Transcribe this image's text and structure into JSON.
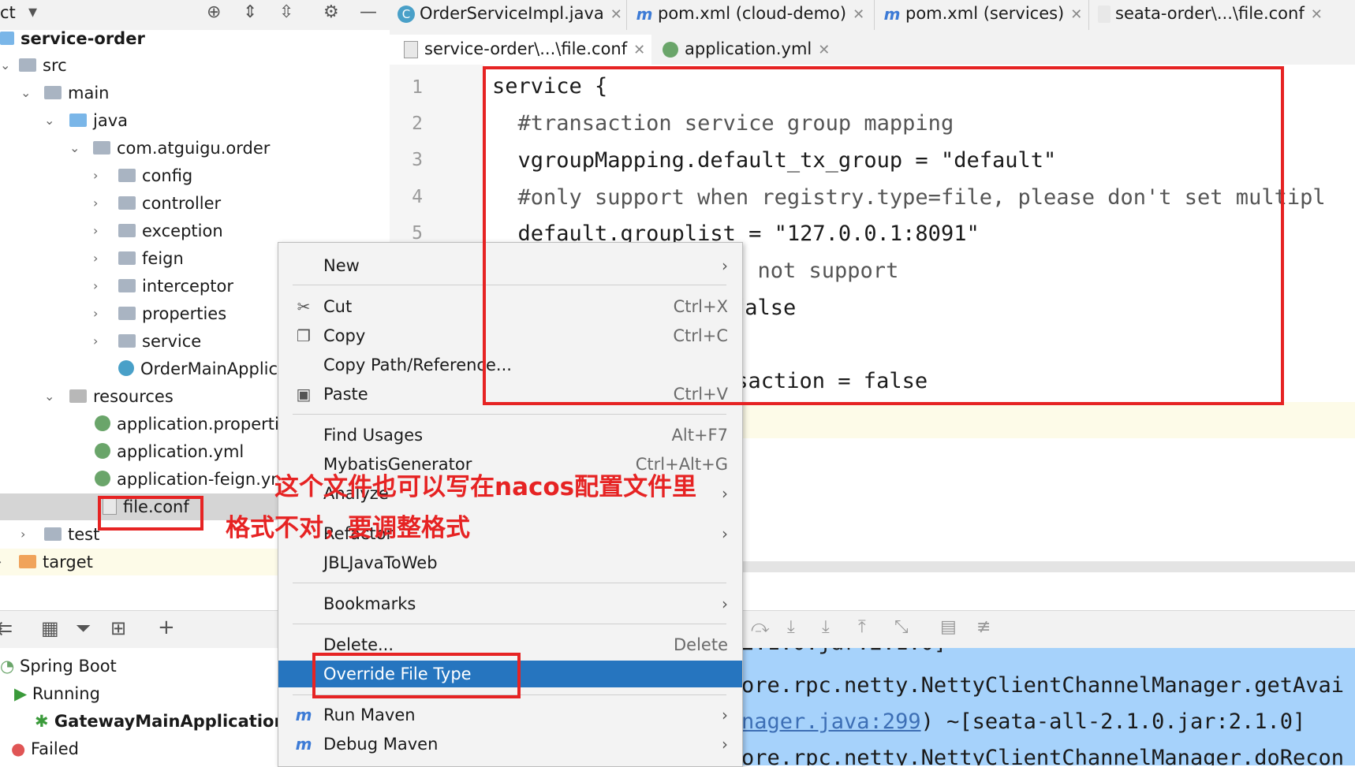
{
  "project_toolbar": {
    "title": "ct"
  },
  "editor_tabs_row1": [
    {
      "label": "OrderServiceImpl.java",
      "icon": "java-class-icon"
    },
    {
      "label": "pom.xml (cloud-demo)",
      "icon": "maven-icon"
    },
    {
      "label": "pom.xml (services)",
      "icon": "maven-icon"
    },
    {
      "label": "seata-order\\...\\file.conf",
      "icon": "text-file-icon"
    }
  ],
  "editor_tabs_row2": [
    {
      "label": "service-order\\...\\file.conf",
      "icon": "text-file-icon",
      "active": true
    },
    {
      "label": "application.yml",
      "icon": "spring-yaml-icon",
      "active": false
    }
  ],
  "tree": {
    "root": "service-order",
    "items": [
      {
        "label": "src"
      },
      {
        "label": "main"
      },
      {
        "label": "java"
      },
      {
        "label": "com.atguigu.order"
      },
      {
        "label": "config"
      },
      {
        "label": "controller"
      },
      {
        "label": "exception"
      },
      {
        "label": "feign"
      },
      {
        "label": "interceptor"
      },
      {
        "label": "properties"
      },
      {
        "label": "service"
      },
      {
        "label": "OrderMainApplic"
      },
      {
        "label": "resources"
      },
      {
        "label": "application.properti"
      },
      {
        "label": "application.yml"
      },
      {
        "label": "application-feign.yr"
      },
      {
        "label": "file.conf"
      },
      {
        "label": "test"
      },
      {
        "label": "target"
      }
    ]
  },
  "editor": {
    "line_numbers": [
      "1",
      "2",
      "3",
      "4",
      "5"
    ],
    "lines": [
      "service {",
      "  #transaction service group mapping",
      "  vgroupMapping.default_tx_group = \"default\"",
      "  #only support when registry.type=file, please don't set multipl",
      "  default.grouplist = \"127.0.0.1:8091\"",
      "t not support",
      "false",
      "nsaction = false"
    ]
  },
  "services_panel": {
    "spring_boot": "Spring Boot",
    "running": "Running",
    "app": "GatewayMainApplication",
    "failed": "Failed"
  },
  "console": {
    "lines": [
      "2.1.0.jar:2.1.0]",
      "ore.rpc.netty.NettyClientChannelManager.getAvai",
      "nager.java:299",
      ") ~[seata-all-2.1.0.jar:2.1.0]",
      "ore.rpc.netty.NettyClientChannelManager.doRecon"
    ]
  },
  "context_menu": {
    "items": [
      {
        "label": "New",
        "shortcut": "",
        "submenu": true,
        "icon": ""
      },
      {
        "label": "Cut",
        "shortcut": "Ctrl+X",
        "submenu": false,
        "icon": "scissors-icon"
      },
      {
        "label": "Copy",
        "shortcut": "Ctrl+C",
        "submenu": false,
        "icon": "copy-icon"
      },
      {
        "label": "Copy Path/Reference...",
        "shortcut": "",
        "submenu": false,
        "icon": ""
      },
      {
        "label": "Paste",
        "shortcut": "Ctrl+V",
        "submenu": false,
        "icon": "clipboard-icon"
      },
      {
        "label": "Find Usages",
        "shortcut": "Alt+F7",
        "submenu": false,
        "icon": ""
      },
      {
        "label": "MybatisGenerator",
        "shortcut": "Ctrl+Alt+G",
        "submenu": false,
        "icon": ""
      },
      {
        "label": "Analyze",
        "shortcut": "",
        "submenu": true,
        "icon": ""
      },
      {
        "label": "Refactor",
        "shortcut": "",
        "submenu": true,
        "icon": ""
      },
      {
        "label": "JBLJavaToWeb",
        "shortcut": "",
        "submenu": false,
        "icon": ""
      },
      {
        "label": "Bookmarks",
        "shortcut": "",
        "submenu": true,
        "icon": ""
      },
      {
        "label": "Delete...",
        "shortcut": "Delete",
        "submenu": false,
        "icon": ""
      },
      {
        "label": "Override File Type",
        "shortcut": "",
        "submenu": false,
        "icon": "",
        "selected": true
      },
      {
        "label": "Run Maven",
        "shortcut": "",
        "submenu": true,
        "icon": "maven-run-icon"
      },
      {
        "label": "Debug Maven",
        "shortcut": "",
        "submenu": true,
        "icon": "maven-debug-icon"
      }
    ]
  },
  "annotations": {
    "note1": "这个文件也可以写在nacos配置文件里",
    "note2": "格式不对，要调整格式"
  },
  "colors": {
    "menu_selected": "#2675bf",
    "annotation_red": "#e62323",
    "console_bg": "#a6d2fb"
  }
}
